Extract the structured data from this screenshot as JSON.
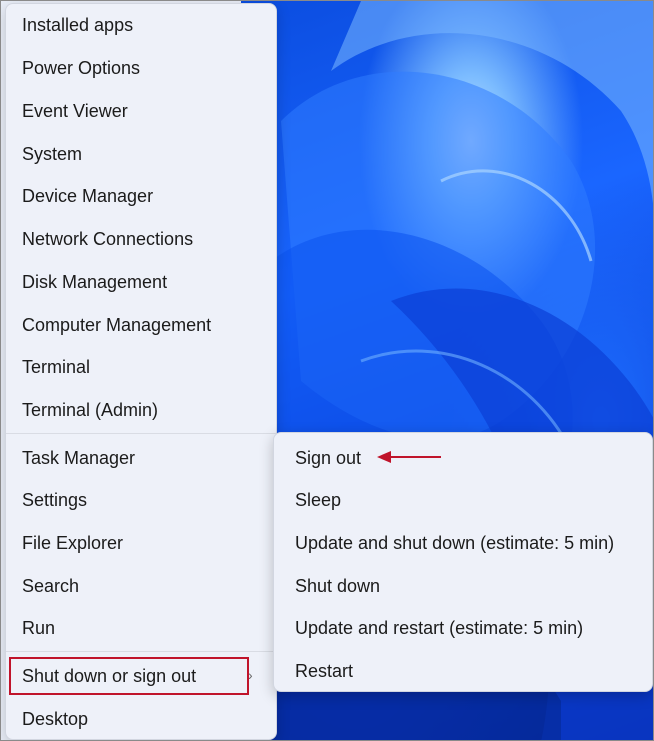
{
  "context_menu": {
    "items": [
      {
        "label": "Installed apps"
      },
      {
        "label": "Power Options"
      },
      {
        "label": "Event Viewer"
      },
      {
        "label": "System"
      },
      {
        "label": "Device Manager"
      },
      {
        "label": "Network Connections"
      },
      {
        "label": "Disk Management"
      },
      {
        "label": "Computer Management"
      },
      {
        "label": "Terminal"
      },
      {
        "label": "Terminal (Admin)"
      },
      {
        "label": "Task Manager"
      },
      {
        "label": "Settings"
      },
      {
        "label": "File Explorer"
      },
      {
        "label": "Search"
      },
      {
        "label": "Run"
      },
      {
        "label": "Shut down or sign out"
      },
      {
        "label": "Desktop"
      }
    ],
    "submenu_indicator_icon": "chevron-right-icon"
  },
  "submenu": {
    "items": [
      {
        "label": "Sign out"
      },
      {
        "label": "Sleep"
      },
      {
        "label": "Update and shut down (estimate: 5 min)"
      },
      {
        "label": "Shut down"
      },
      {
        "label": "Update and restart (estimate: 5 min)"
      },
      {
        "label": "Restart"
      }
    ]
  },
  "annotations": {
    "highlight_color": "#c0142b",
    "arrow_icon": "left-arrow-icon"
  },
  "wallpaper": {
    "primary_color": "#1a66ff",
    "dark_color": "#041f8a"
  }
}
